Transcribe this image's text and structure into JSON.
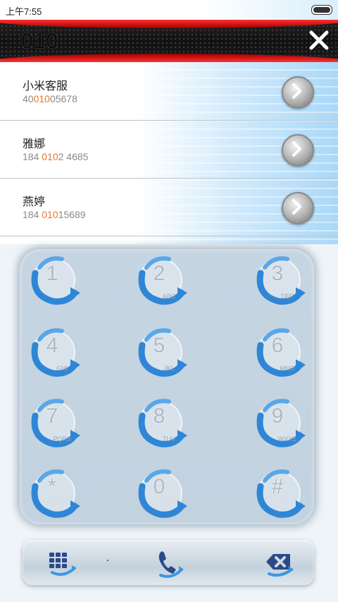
{
  "status_bar": {
    "time": "上午7:55"
  },
  "header": {
    "dial_input": "010"
  },
  "results": [
    {
      "name": "小米客服",
      "number_pre": "40",
      "number_match": "010",
      "number_post": "05678"
    },
    {
      "name": "雅娜",
      "number_pre": "184 ",
      "number_match": "010",
      "number_post": "2 4685"
    },
    {
      "name": "燕婷",
      "number_pre": "184 ",
      "number_match": "010",
      "number_post": "15689"
    }
  ],
  "keypad": [
    {
      "digit": "1",
      "letters": ""
    },
    {
      "digit": "2",
      "letters": "ABC"
    },
    {
      "digit": "3",
      "letters": "DEF"
    },
    {
      "digit": "4",
      "letters": "GHI"
    },
    {
      "digit": "5",
      "letters": "JKL"
    },
    {
      "digit": "6",
      "letters": "MNO"
    },
    {
      "digit": "7",
      "letters": "PQRS"
    },
    {
      "digit": "8",
      "letters": "TUV"
    },
    {
      "digit": "9",
      "letters": "WXYZ"
    },
    {
      "digit": "*",
      "letters": ""
    },
    {
      "digit": "0",
      "letters": ""
    },
    {
      "digit": "#",
      "letters": ""
    }
  ],
  "colors": {
    "match_highlight": "#e8782a",
    "arrow_blue": "#2f86d6",
    "header_red": "#d01010"
  },
  "icons": {
    "close": "close-icon",
    "result_action": "chevron-right-icon",
    "bottom": [
      "dialpad-icon",
      "phone-call-icon",
      "delete-backspace-icon"
    ]
  }
}
